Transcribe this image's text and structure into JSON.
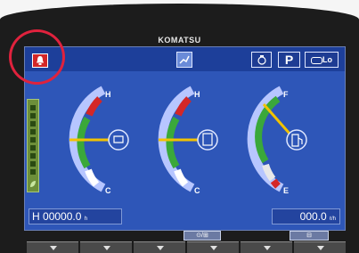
{
  "brand": "KOMATSU",
  "topbar": {
    "p_label": "P",
    "lo_label": "Lo",
    "alarm_icon": "alarm-bell-icon",
    "mode_icon": "work-mode-icon",
    "service_icon": "service-meter-icon",
    "hydraulic_icon": "hydraulic-icon"
  },
  "gauges": {
    "coolant": {
      "high": "H",
      "low": "C",
      "icon": "coolant-temp-icon",
      "level": 0.5
    },
    "hydraulic": {
      "high": "H",
      "low": "C",
      "icon": "hydraulic-oil-temp-icon",
      "level": 0.5
    },
    "fuel": {
      "high": "F",
      "low": "E",
      "icon": "fuel-icon",
      "level": 0.75
    }
  },
  "hour_meter": {
    "prefix": "H",
    "value": "00000.0",
    "unit": "h"
  },
  "fuel_consumption": {
    "value": "000.0",
    "unit": "ℓ/h"
  },
  "soft_buttons": {
    "left": "⊙/⊞",
    "right": "⊟"
  },
  "colors": {
    "screen": "#2e56b8",
    "gauge_green": "#3aa83a",
    "gauge_red": "#d42727",
    "needle": "#f2c200",
    "highlight_circle": "#e0223d"
  }
}
